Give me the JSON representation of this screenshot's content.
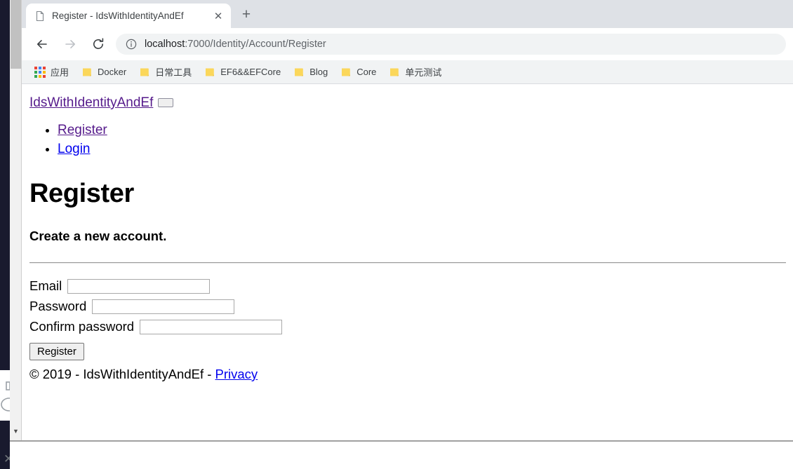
{
  "browser": {
    "tab": {
      "title": "Register - IdsWithIdentityAndEf",
      "favicon_name": "page-icon",
      "close_glyph": "✕"
    },
    "new_tab_glyph": "+",
    "toolbar": {
      "back_glyph": "←",
      "forward_glyph": "→",
      "reload_glyph": "⟳",
      "site_info_glyph": "ⓘ",
      "url_host": "localhost",
      "url_rest": ":7000/Identity/Account/Register",
      "url_full": "localhost:7000/Identity/Account/Register"
    },
    "bookmarks": [
      {
        "label": "应用",
        "icon": "apps-grid-icon"
      },
      {
        "label": "Docker",
        "icon": "folder-icon"
      },
      {
        "label": "日常工具",
        "icon": "folder-icon"
      },
      {
        "label": "EF6&&EFCore",
        "icon": "folder-icon"
      },
      {
        "label": "Blog",
        "icon": "folder-icon"
      },
      {
        "label": "Core",
        "icon": "folder-icon"
      },
      {
        "label": "单元测试",
        "icon": "folder-icon"
      }
    ],
    "scrollbar": {
      "down_arrow_glyph": "▼"
    }
  },
  "page": {
    "brand": "IdsWithIdentityAndEf",
    "nav_items": [
      {
        "label": "Register",
        "state": "visited"
      },
      {
        "label": "Login",
        "state": "unvisited"
      }
    ],
    "title": "Register",
    "subtitle": "Create a new account.",
    "form": {
      "fields": [
        {
          "label": "Email",
          "value": "",
          "type": "text"
        },
        {
          "label": "Password",
          "value": "",
          "type": "password"
        },
        {
          "label": "Confirm password",
          "value": "",
          "type": "password"
        }
      ],
      "submit_label": "Register"
    },
    "footer": {
      "copyright": "© 2019 - IdsWithIdentityAndEf - ",
      "privacy_label": "Privacy"
    }
  },
  "desktop": {
    "close_glyph": "✕"
  },
  "colors": {
    "visited_link": "#551a8b",
    "unvisited_link": "#0000ee",
    "tabstrip_bg": "#dee1e6",
    "bookmarks_bg": "#f1f3f4",
    "omnibox_bg": "#f1f3f4",
    "folder_icon": "#fbd75b",
    "desktop_bg": "#191a2e"
  }
}
